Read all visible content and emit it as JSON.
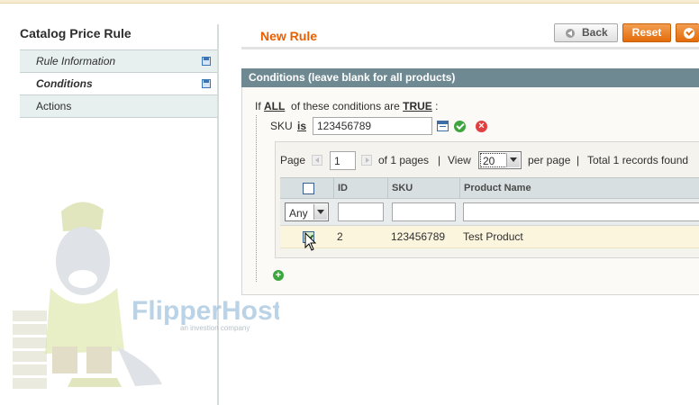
{
  "sidebar": {
    "title": "Catalog Price Rule",
    "tabs": [
      {
        "label": "Rule Information"
      },
      {
        "label": "Conditions"
      },
      {
        "label": "Actions"
      }
    ]
  },
  "header": {
    "title": "New Rule",
    "back_label": "Back",
    "reset_label": "Reset"
  },
  "watermark": {
    "brand": "FlipperHost",
    "tagline": "an investion company"
  },
  "conditions": {
    "heading": "Conditions (leave blank for all products)",
    "prefix": "If",
    "aggregator": "ALL",
    "middle": "of these conditions are",
    "value": "TRUE",
    "suffix": ":",
    "sku_label": "SKU",
    "operator": "is",
    "sku_value": "123456789"
  },
  "grid": {
    "page_label": "Page",
    "page_value": "1",
    "of_pages": "of 1 pages",
    "sep": "|",
    "view_label": "View",
    "view_value": "20",
    "per_page": "per page",
    "total": "Total 1 records found",
    "columns": [
      "ID",
      "SKU",
      "Product Name"
    ],
    "filter_any": "Any",
    "rows": [
      {
        "id": "2",
        "sku": "123456789",
        "name": "Test Product"
      }
    ]
  },
  "colors": {
    "accent": "#eb5e00",
    "section_header": "#6f8992",
    "row_highlight": "#fcf5dd"
  }
}
